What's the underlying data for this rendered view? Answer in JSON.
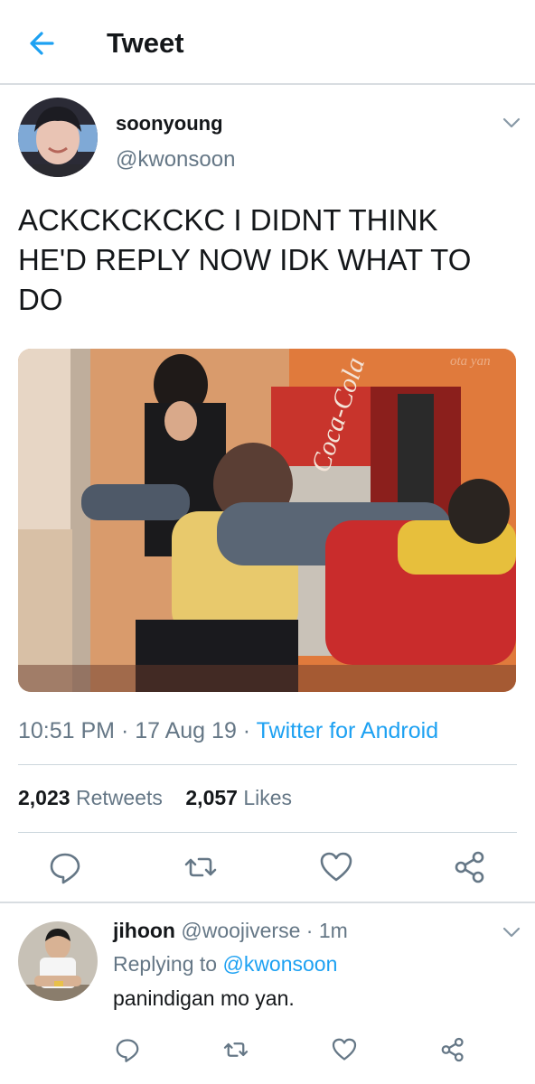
{
  "header": {
    "title": "Tweet"
  },
  "tweet": {
    "display_name": "soonyoung",
    "handle": "@kwonsoon",
    "text": "ACKCKCKCKC I DIDNT THINK HE'D REPLY NOW IDK WHAT TO DO",
    "time": "10:51 PM",
    "sep1": " · ",
    "date": "17 Aug 19",
    "sep2": " · ",
    "source": "Twitter for Android",
    "retweets_count": "2,023",
    "retweets_label": "Retweets",
    "likes_count": "2,057",
    "likes_label": "Likes",
    "media_watermark": "Coca-Cola",
    "media_corner_text": "ota yan"
  },
  "reply": {
    "display_name": "jihoon",
    "handle": "@woojiverse",
    "dot": " · ",
    "time": "1m",
    "replying_prefix": "Replying to ",
    "replying_to": "@kwonsoon",
    "text": "panindigan mo yan."
  },
  "icons": {
    "back": "arrow-left-icon",
    "menu": "chevron-down-icon",
    "reply": "comment-icon",
    "retweet": "retweet-icon",
    "like": "heart-icon",
    "share": "share-icon"
  },
  "colors": {
    "accent": "#1da1f2",
    "secondary_text": "#657786",
    "primary_text": "#14171a",
    "divider": "#ccd6dd"
  }
}
